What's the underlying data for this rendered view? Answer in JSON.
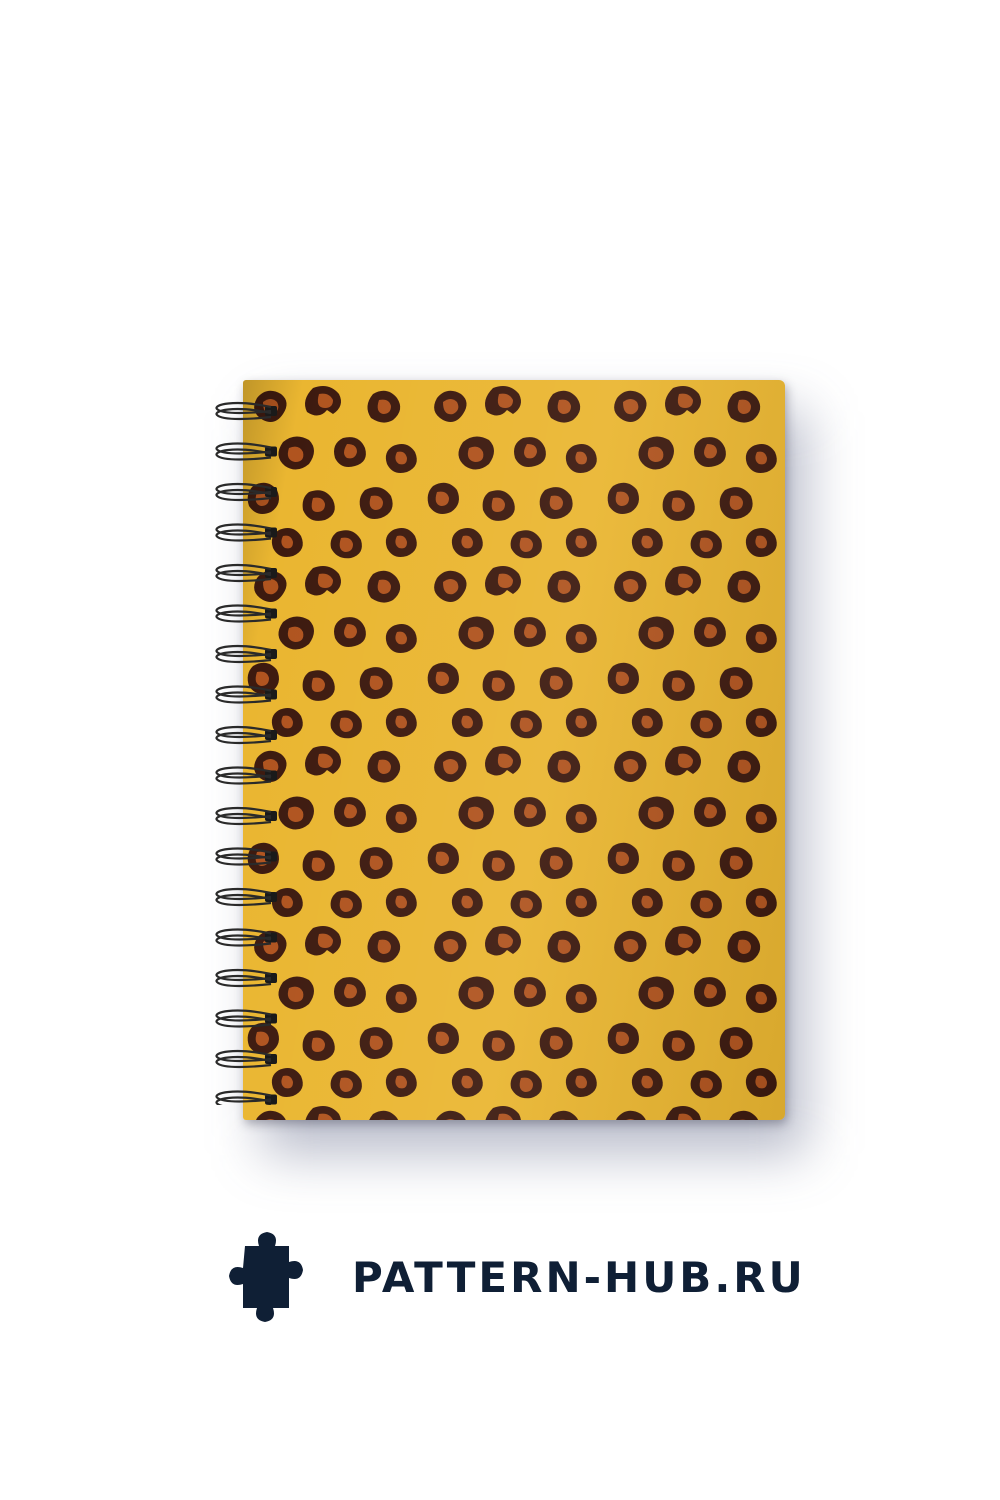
{
  "brand": {
    "site": "PATTERN-HUB.RU",
    "logo_icon": "puzzle-piece-icon",
    "text_color": "#0f1f35"
  },
  "notebook": {
    "pattern": "leopard-print",
    "colors": {
      "background": "#eab631",
      "spot_outline": "#3d1a0f",
      "spot_fill": "#b0541f",
      "spiral": "#2a2a2a"
    }
  }
}
